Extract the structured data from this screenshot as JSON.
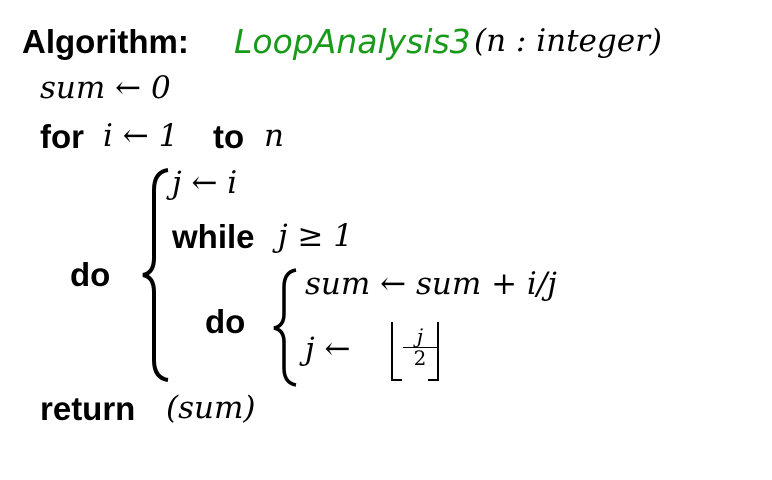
{
  "header": {
    "keyword": "Algorithm:",
    "name": "LoopAnalysis3",
    "params": "(n : integer)",
    "name_color": "#1a9a1a"
  },
  "lines": {
    "init": "sum ← 0",
    "for_keyword": "for",
    "for_var": "i ← 1",
    "to_keyword": "to",
    "for_end": "n",
    "do_keyword": "do",
    "assign_j": "j ← i",
    "while_keyword": "while",
    "while_cond": "j ≥ 1",
    "inner_do_keyword": "do",
    "sum_update": "sum ← sum + i/j",
    "j_update_lhs": "j ←",
    "floor_num": "j",
    "floor_den": "2",
    "return_keyword": "return",
    "return_value": "(sum)"
  }
}
